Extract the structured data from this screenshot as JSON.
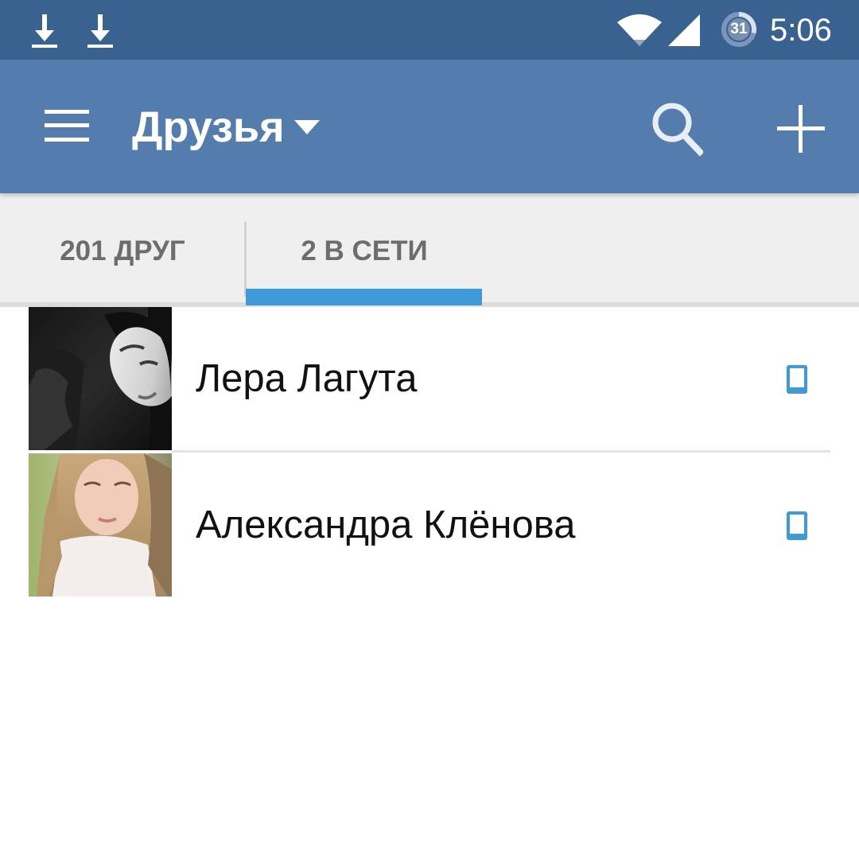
{
  "status_bar": {
    "icons": [
      "download-icon",
      "download-icon",
      "wifi-icon",
      "signal-icon",
      "battery-icon"
    ],
    "battery_level": "31",
    "time": "5:06"
  },
  "toolbar": {
    "menu_icon": "hamburger-menu-icon",
    "title": "Друзья",
    "dropdown_icon": "caret-down-icon",
    "search_icon": "search-icon",
    "add_icon": "plus-icon"
  },
  "tabs": [
    {
      "label": "201 ДРУГ",
      "active": false
    },
    {
      "label": "2 В СЕТИ",
      "active": true
    }
  ],
  "friends": [
    {
      "name": "Лера Лагута",
      "status_icon": "mobile-phone-icon"
    },
    {
      "name": "Александра Клёнова",
      "status_icon": "mobile-phone-icon"
    }
  ],
  "colors": {
    "status_bar": "#3a6291",
    "toolbar": "#547dad",
    "tab_background": "#efefef",
    "tab_indicator": "#3e9ad9",
    "tab_text": "#6d6d6d",
    "online_icon": "#3e9ad9"
  }
}
